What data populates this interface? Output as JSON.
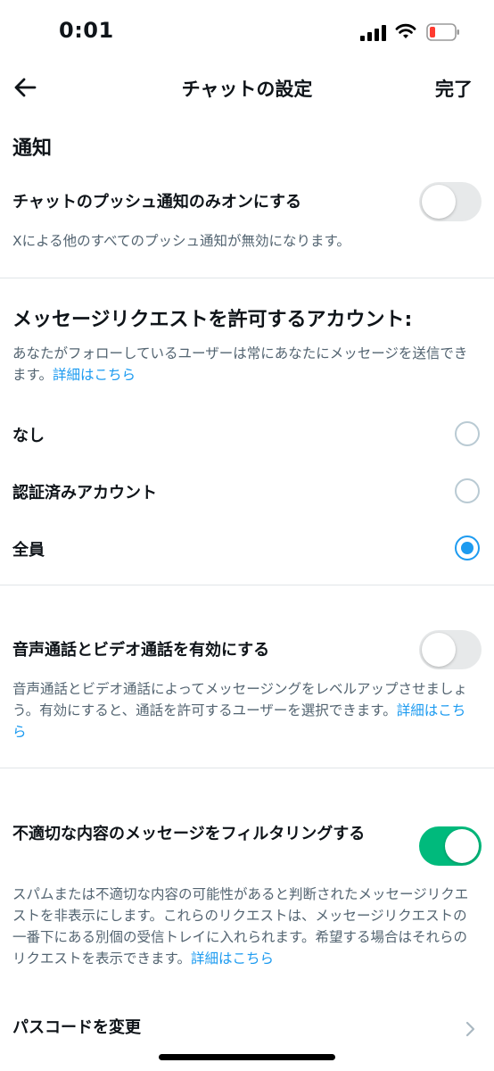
{
  "status_bar": {
    "time": "0:01"
  },
  "nav": {
    "title": "チャットの設定",
    "done_label": "完了"
  },
  "notifications": {
    "heading": "通知",
    "push_only_label": "チャットのプッシュ通知のみオンにする",
    "push_only_on": false,
    "push_only_desc": "Xによる他のすべてのプッシュ通知が無効になります。"
  },
  "message_requests": {
    "heading": "メッセージリクエストを許可するアカウント:",
    "desc": "あなたがフォローしているユーザーは常にあなたにメッセージを送信できます。",
    "learn_more": "詳細はこちら",
    "options": [
      {
        "label": "なし",
        "selected": false
      },
      {
        "label": "認証済みアカウント",
        "selected": false
      },
      {
        "label": "全員",
        "selected": true
      }
    ]
  },
  "calls": {
    "label": "音声通話とビデオ通話を有効にする",
    "on": false,
    "desc": "音声通話とビデオ通話によってメッセージングをレベルアップさせましょう。有効にすると、通話を許可するユーザーを選択できます。",
    "learn_more": "詳細はこちら"
  },
  "filter": {
    "label": "不適切な内容のメッセージをフィルタリングする",
    "on": true,
    "desc": "スパムまたは不適切な内容の可能性があると判断されたメッセージリクエストを非表示にします。これらのリクエストは、メッセージリクエストの一番下にある別個の受信トレイに入れられます。希望する場合はそれらのリクエストを表示できます。",
    "learn_more": "詳細はこちら"
  },
  "passcode": {
    "label": "パスコードを変更"
  },
  "colors": {
    "accent": "#1d9bf0",
    "toggle_on": "#00ba7c",
    "toggle_off": "#e7e9ea",
    "secondary_text": "#536471"
  },
  "icons": {
    "back": "arrow-left-icon",
    "signal": "cellular-signal-icon",
    "wifi": "wifi-icon",
    "battery": "battery-low-icon",
    "chevron": "chevron-right-icon"
  }
}
